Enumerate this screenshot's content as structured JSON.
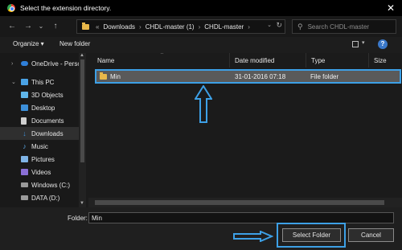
{
  "dialog": {
    "title": "Select the extension directory.",
    "close_glyph": "✕"
  },
  "nav": {
    "back_glyph": "←",
    "forward_glyph": "→",
    "recent_glyph": "⌄",
    "up_glyph": "↑"
  },
  "address": {
    "overflow_glyph": "«",
    "crumbs": [
      "Downloads",
      "CHDL-master (1)",
      "CHDL-master"
    ],
    "separator": "›",
    "dropdown_glyph": "⌄",
    "refresh_glyph": "↻"
  },
  "search": {
    "placeholder": "Search CHDL-master",
    "glyph": "⚲"
  },
  "toolbar": {
    "organize_label": "Organize ▾",
    "new_folder_label": "New folder",
    "view_drop_glyph": "▾",
    "help_glyph": "?"
  },
  "sidebar": {
    "items": [
      {
        "label": "OneDrive - Person",
        "chev": "›",
        "icon": "cloud-icon",
        "color": "#2f7fd8"
      },
      {
        "label": "This PC",
        "chev": "⌄",
        "icon": "computer-icon",
        "color": "#4aa3e6"
      },
      {
        "label": "3D Objects",
        "chev": "",
        "icon": "cube-icon",
        "color": "#5fb6ea"
      },
      {
        "label": "Desktop",
        "chev": "",
        "icon": "desktop-icon",
        "color": "#3c8fd9"
      },
      {
        "label": "Documents",
        "chev": "",
        "icon": "document-icon",
        "color": "#cfcfcf"
      },
      {
        "label": "Downloads",
        "chev": "",
        "icon": "download-icon",
        "color": "#3c8fd9"
      },
      {
        "label": "Music",
        "chev": "",
        "icon": "music-icon",
        "color": "#5aa5e0"
      },
      {
        "label": "Pictures",
        "chev": "",
        "icon": "pictures-icon",
        "color": "#7fb4e6"
      },
      {
        "label": "Videos",
        "chev": "",
        "icon": "videos-icon",
        "color": "#8a6fd6"
      },
      {
        "label": "Windows (C:)",
        "chev": "",
        "icon": "drive-icon",
        "color": "#9a9a9a"
      },
      {
        "label": "DATA (D:)",
        "chev": "",
        "icon": "drive-icon",
        "color": "#9a9a9a"
      }
    ],
    "selected_index": 5,
    "scroll_up_glyph": "▲",
    "scroll_down_glyph": "▼"
  },
  "files": {
    "columns": [
      "Name",
      "Date modified",
      "Type",
      "Size"
    ],
    "sort_glyph": "^",
    "rows": [
      {
        "name": "Min",
        "date": "31-01-2016 07:18",
        "type": "File folder",
        "size": ""
      }
    ]
  },
  "footer": {
    "folder_label": "Folder:",
    "folder_value": "Min",
    "select_label": "Select Folder",
    "cancel_label": "Cancel"
  },
  "colors": {
    "highlight": "#3da0e6",
    "folder": "#e8b84a"
  }
}
